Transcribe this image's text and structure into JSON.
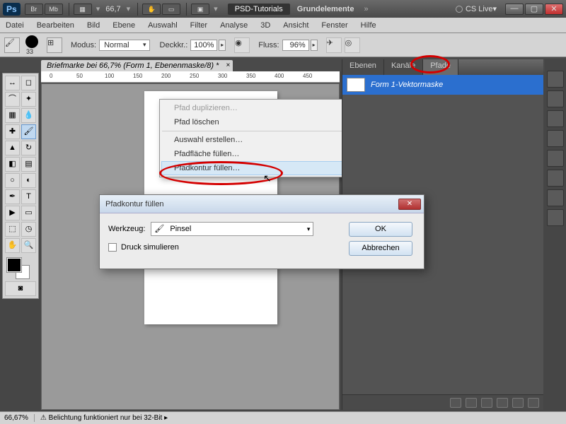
{
  "titlebar": {
    "zoom": "66,7",
    "crumb1": "PSD-Tutorials",
    "crumb2": "Grundelemente",
    "cslive": "CS Live",
    "br": "Br",
    "mb": "Mb"
  },
  "menu": [
    "Datei",
    "Bearbeiten",
    "Bild",
    "Ebene",
    "Auswahl",
    "Filter",
    "Analyse",
    "3D",
    "Ansicht",
    "Fenster",
    "Hilfe"
  ],
  "opt": {
    "brushnum": "33",
    "modus_lbl": "Modus:",
    "modus": "Normal",
    "deck_lbl": "Deckkr.:",
    "deck": "100%",
    "fluss_lbl": "Fluss:",
    "fluss": "96%"
  },
  "doctab": "Briefmarke bei 66,7% (Form 1, Ebenenmaske/8) *",
  "ruler": [
    "0",
    "50",
    "100",
    "150",
    "200",
    "250",
    "300",
    "350",
    "400",
    "450"
  ],
  "panel": {
    "tab1": "Ebenen",
    "tab2": "Kanäle",
    "tab3": "Pfade",
    "path": "Form 1-Vektormaske"
  },
  "ctx": {
    "m1": "Pfad duplizieren…",
    "m2": "Pfad löschen",
    "m3": "Auswahl erstellen…",
    "m4": "Pfadfläche füllen…",
    "m5": "Pfadkontur füllen…"
  },
  "dialog": {
    "title": "Pfadkontur füllen",
    "tool_lbl": "Werkzeug:",
    "tool": "Pinsel",
    "simulate": "Druck simulieren",
    "ok": "OK",
    "cancel": "Abbrechen"
  },
  "status": {
    "zoom": "66,67%",
    "msg": "Belichtung funktioniert nur bei 32-Bit"
  }
}
